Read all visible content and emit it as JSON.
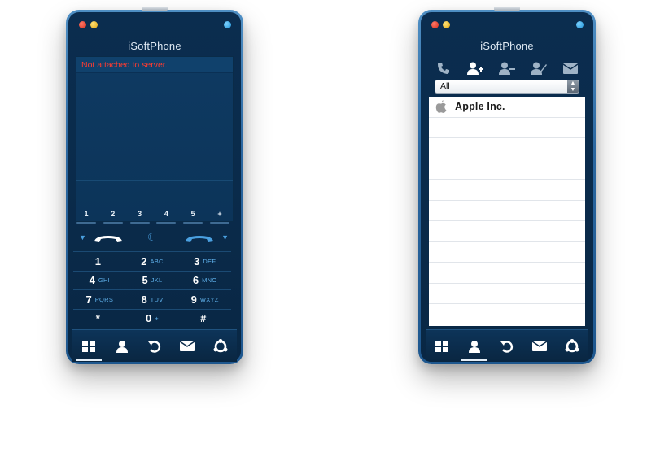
{
  "left_phone": {
    "title": "iSoftPhone",
    "status": "Not attached to server.",
    "lines": [
      "1",
      "2",
      "3",
      "4",
      "5",
      "+"
    ],
    "keypad": [
      [
        {
          "num": "1",
          "letters": ""
        },
        {
          "num": "2",
          "letters": "ABC"
        },
        {
          "num": "3",
          "letters": "DEF"
        }
      ],
      [
        {
          "num": "4",
          "letters": "GHI"
        },
        {
          "num": "5",
          "letters": "JKL"
        },
        {
          "num": "6",
          "letters": "MNO"
        }
      ],
      [
        {
          "num": "7",
          "letters": "PQRS"
        },
        {
          "num": "8",
          "letters": "TUV"
        },
        {
          "num": "9",
          "letters": "WXYZ"
        }
      ],
      [
        {
          "num": "*",
          "letters": ""
        },
        {
          "num": "0",
          "letters": "+"
        },
        {
          "num": "#",
          "letters": ""
        }
      ]
    ],
    "active_tab": "keypad"
  },
  "right_phone": {
    "title": "iSoftPhone",
    "filter": {
      "selected": "All"
    },
    "contacts": [
      {
        "name": "Apple  Inc.",
        "icon": "apple-logo-icon"
      }
    ],
    "active_tab": "contacts"
  },
  "tabs": [
    "keypad-icon",
    "contacts-icon",
    "recents-icon",
    "messages-icon",
    "conference-icon"
  ],
  "colors": {
    "status_error": "#ff3b30",
    "accent_blue": "#4aa0e0",
    "frame": "#2b67a0",
    "background": "#0b2d4f"
  }
}
